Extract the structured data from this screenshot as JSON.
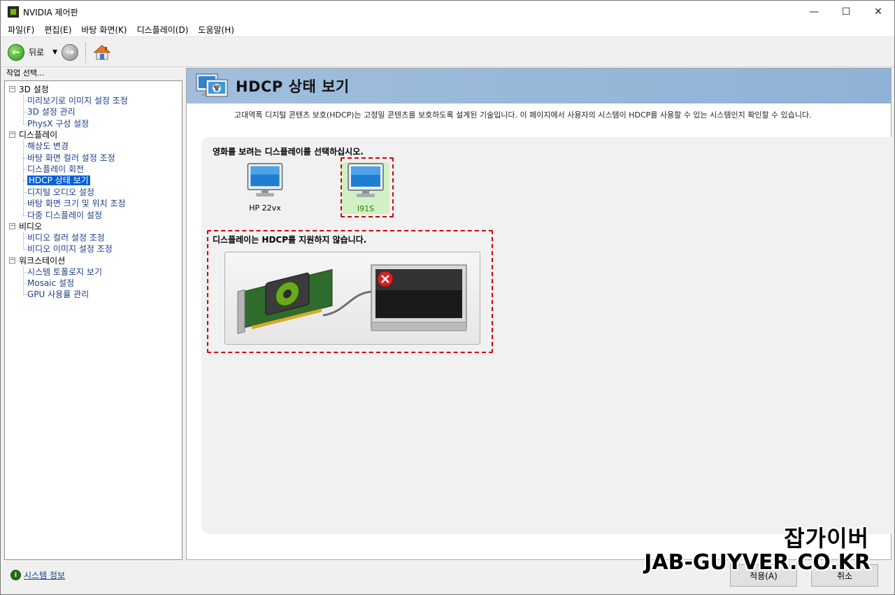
{
  "window": {
    "title": "NVIDIA 제어판",
    "controls": {
      "minimize": "—",
      "maximize": "☐",
      "close": "✕"
    }
  },
  "menubar": {
    "items": [
      "파일(F)",
      "편집(E)",
      "바탕 화면(K)",
      "디스플레이(D)",
      "도움말(H)"
    ]
  },
  "toolbar": {
    "back_label": "뒤로",
    "dropdown_glyph": "▼",
    "back_glyph": "←",
    "forward_glyph": "→"
  },
  "left_panel": {
    "header": "작업 선택...",
    "categories": [
      {
        "label": "3D 설정",
        "toggle": "−",
        "items": [
          "미리보기로 이미지 설정 조정",
          "3D 설정 관리",
          "PhysX 구성 설정"
        ]
      },
      {
        "label": "디스플레이",
        "toggle": "−",
        "items": [
          "해상도 변경",
          "바탕 화면 컬러 설정 조정",
          "디스플레이 회전",
          "HDCP 상태 보기",
          "디지털 오디오 설정",
          "바탕 화면 크기 및 위치 조정",
          "다중 디스플레이 설정"
        ]
      },
      {
        "label": "비디오",
        "toggle": "−",
        "items": [
          "비디오 컬러 설정 조정",
          "비디오 이미지 설정 조정"
        ]
      },
      {
        "label": "워크스테이션",
        "toggle": "−",
        "items": [
          "시스템 토폴로지 보기",
          "Mosaic 설정",
          "GPU 사용률 관리"
        ]
      }
    ],
    "selected_item": "HDCP 상태 보기",
    "system_info_link": "시스템 정보"
  },
  "right_panel": {
    "title": "HDCP 상태 보기",
    "description": "고대역폭 디지털 콘텐츠 보호(HDCP)는 고정밀 콘텐츠를 보호하도록 설계된 기술입니다. 이 페이지에서 사용자의 시스템이 HDCP를 사용할 수 있는 시스템인지 확인할 수 있습니다.",
    "select_display_label": "영화를 보려는 디스플레이를 선택하십시오.",
    "displays": [
      {
        "name": "HP 22vx",
        "selected": false
      },
      {
        "name": "I91S",
        "selected": true
      }
    ],
    "status_label": "디스플레이는 HDCP를 지원하지 않습니다."
  },
  "buttons": {
    "apply": "적용(A)",
    "cancel": "취소"
  },
  "watermark": {
    "korean": "잡가이버",
    "english": "JAB-GUYVER.CO.KR"
  },
  "colors": {
    "header_bar": "#a0bedc",
    "selection": "#0a60d6",
    "link": "#1b3f86",
    "annotation_dash": "#d40000",
    "selected_display_bg": "#d3f0c4"
  }
}
